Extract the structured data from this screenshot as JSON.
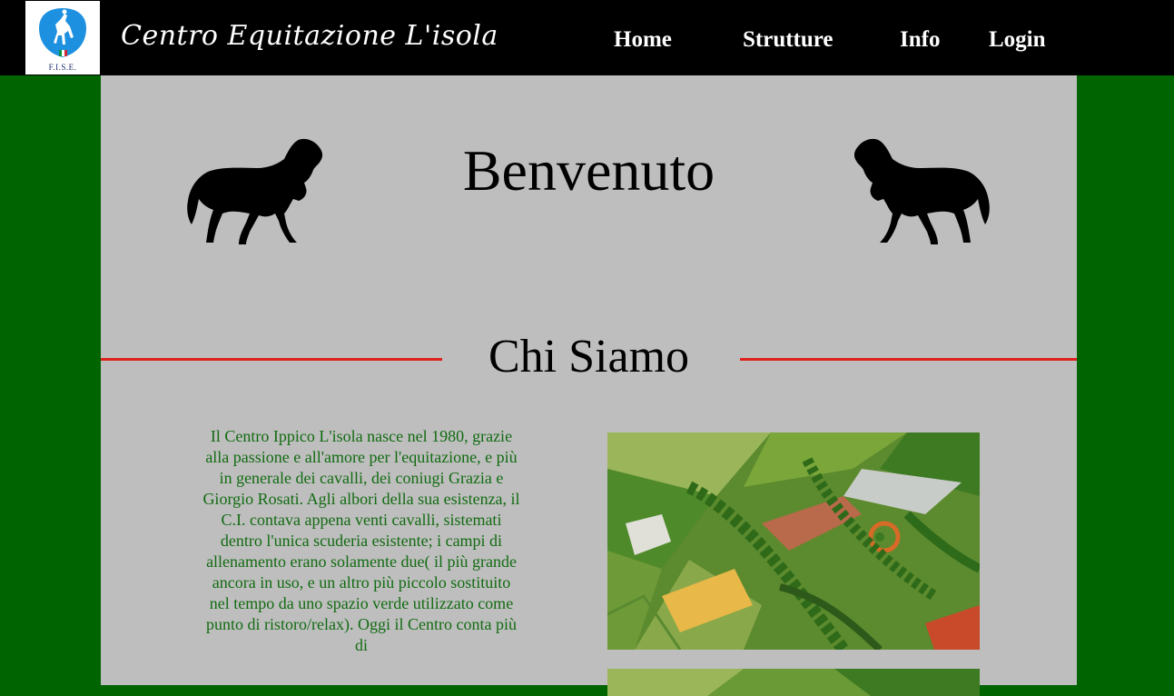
{
  "header": {
    "logo_text": "F.I.S.E.",
    "brand": "Centro Equitazione L'isola",
    "nav": [
      {
        "label": "Home"
      },
      {
        "label": "Strutture"
      },
      {
        "label": "Info"
      },
      {
        "label": "Login"
      }
    ]
  },
  "main": {
    "welcome": "Benvenuto",
    "section_title": "Chi Siamo",
    "about_text": "Il Centro Ippico L'isola nasce nel 1980, grazie alla passione e all'amore per l'equitazione, e più in generale dei cavalli, dei coniugi Grazia e Giorgio Rosati. Agli albori della sua esistenza, il C.I. contava appena venti cavalli, sistemati dentro l'unica scuderia esistente; i campi di allenamento erano solamente due( il più grande ancora in uso, e un altro più piccolo sostituito nel tempo da uno spazio verde utilizzato come punto di ristoro/relax). Oggi il Centro conta più di"
  },
  "colors": {
    "page_bg": "#006400",
    "topbar": "#000000",
    "content_bg": "#bebebe",
    "divider": "#e0201a",
    "body_text": "#126b12"
  }
}
